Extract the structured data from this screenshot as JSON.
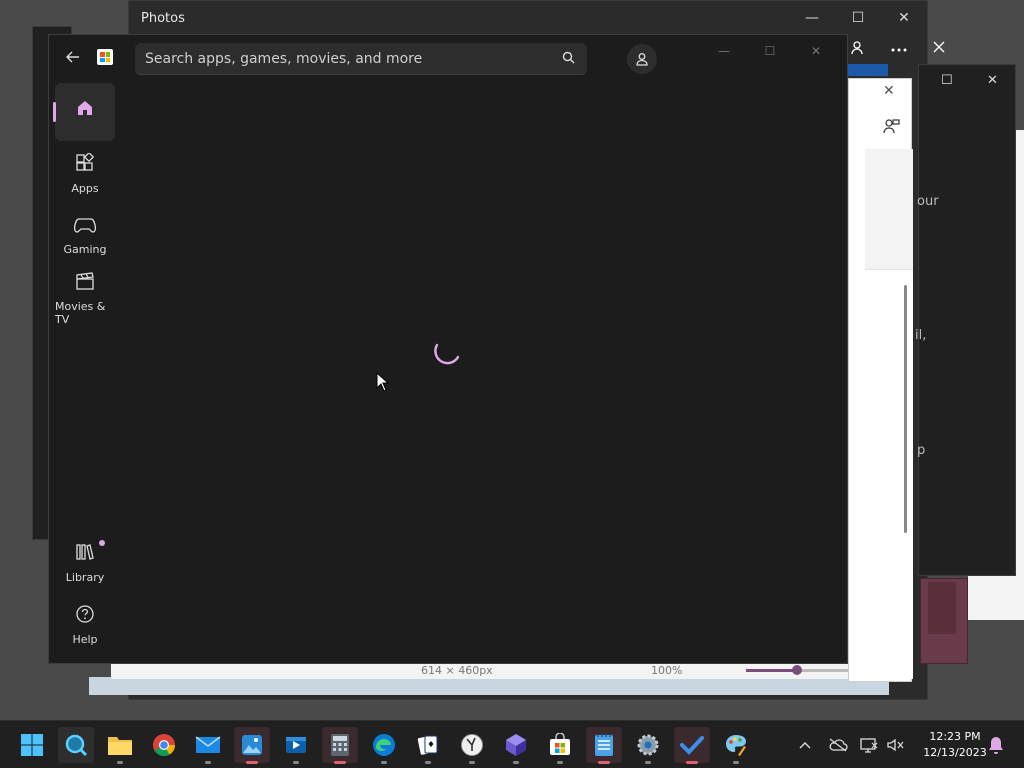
{
  "photos_window": {
    "title": "Photos",
    "footer_dimensions": "614 × 460px",
    "footer_zoom": "100%",
    "zoom_plus": "+",
    "minimize": "—",
    "maximize": "☐",
    "close": "✕"
  },
  "background_fragments": [
    "our",
    "il,",
    "p"
  ],
  "store": {
    "search_placeholder": "Search apps, games, movies, and more",
    "back_label": "←",
    "minimize": "—",
    "maximize": "☐",
    "close": "✕",
    "nav": [
      {
        "label": "",
        "icon": "home-icon"
      },
      {
        "label": "Apps",
        "icon": "apps-icon"
      },
      {
        "label": "Gaming",
        "icon": "gamepad-icon"
      },
      {
        "label": "Movies & TV",
        "icon": "clapperboard-icon"
      },
      {
        "label": "Library",
        "icon": "library-icon"
      },
      {
        "label": "Help",
        "icon": "help-icon"
      }
    ],
    "accent_color": "#e0a8e8",
    "loading": true
  },
  "taskbar": {
    "apps": [
      {
        "name": "start",
        "icon": "windows-icon"
      },
      {
        "name": "search",
        "icon": "search-icon"
      },
      {
        "name": "file-explorer",
        "icon": "folder-icon"
      },
      {
        "name": "chrome",
        "icon": "chrome-icon"
      },
      {
        "name": "mail",
        "icon": "mail-icon"
      },
      {
        "name": "photos",
        "icon": "photos-icon"
      },
      {
        "name": "video-editor",
        "icon": "video-icon"
      },
      {
        "name": "calculator",
        "icon": "calculator-icon"
      },
      {
        "name": "edge",
        "icon": "edge-icon"
      },
      {
        "name": "solitaire",
        "icon": "cards-icon"
      },
      {
        "name": "clock",
        "icon": "clock-icon"
      },
      {
        "name": "app-3d",
        "icon": "cube-icon"
      },
      {
        "name": "store",
        "icon": "store-icon"
      },
      {
        "name": "notepad",
        "icon": "notepad-icon"
      },
      {
        "name": "settings",
        "icon": "gear-icon"
      },
      {
        "name": "todo",
        "icon": "check-icon"
      },
      {
        "name": "paint",
        "icon": "palette-icon"
      }
    ],
    "time": "12:23 PM",
    "date": "12/13/2023"
  }
}
